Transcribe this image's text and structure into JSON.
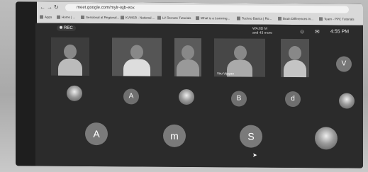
{
  "browser": {
    "url": "meet.google.com/mylr-isjb-eox",
    "nav": {
      "back": "←",
      "forward": "→",
      "reload": "↻"
    },
    "bookmarks": [
      "Apps",
      "Home | ...",
      "Sessional at Regional...",
      "KVMSR - National ...",
      "LV Remote Tutorials",
      "What is a Learning...",
      "Techno Basics | Ro...",
      "Brain Differences in...",
      "Team - PPC Tutorials"
    ]
  },
  "meet": {
    "rec_label": "REC",
    "participants_line1": "WAJID M",
    "participants_line2": "and 43 more",
    "time": "4:55 PM",
    "tiles": [
      {
        "label": ""
      },
      {
        "label": ""
      },
      {
        "label": ""
      },
      {
        "label": "Viru Vijayan"
      },
      {
        "label": ""
      }
    ],
    "row_top_avatar": {
      "letter": "V"
    },
    "row_mid_avatars": [
      {
        "letter": "",
        "type": "photo"
      },
      {
        "letter": "A",
        "type": "letter"
      },
      {
        "letter": "",
        "type": "photo"
      },
      {
        "letter": "B",
        "type": "letter"
      },
      {
        "letter": "d",
        "type": "letter"
      },
      {
        "letter": "",
        "type": "photo"
      }
    ],
    "row_bottom_avatars": [
      {
        "letter": "A",
        "type": "letter"
      },
      {
        "letter": "m",
        "type": "letter"
      },
      {
        "letter": "S",
        "type": "letter"
      },
      {
        "letter": "",
        "type": "photo"
      }
    ]
  },
  "colors": {
    "meet_bg": "#2b2b2b",
    "avatar": "#7a7a7a",
    "browser_bar": "#d9d9d9"
  }
}
